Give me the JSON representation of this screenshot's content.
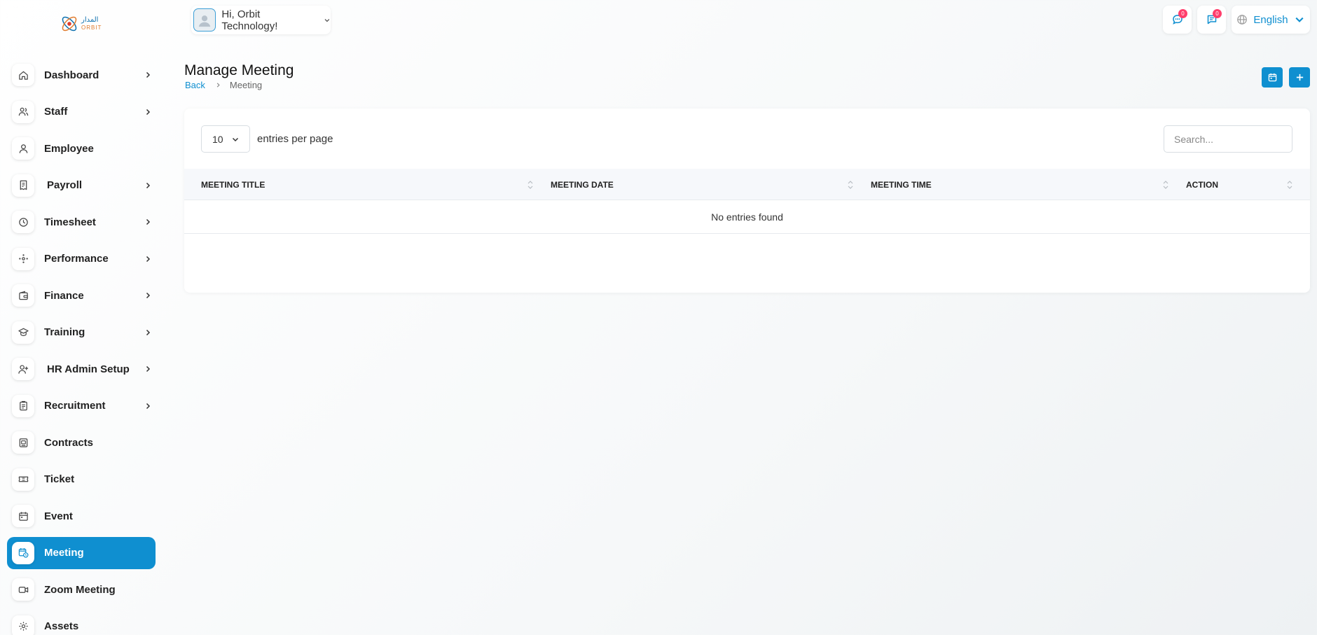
{
  "logo": {
    "arabic": "المدار",
    "latin": "ORBIT"
  },
  "sidebar": {
    "items": [
      {
        "label": "Dashboard",
        "icon": "home-icon",
        "chevron": true
      },
      {
        "label": "Staff",
        "icon": "users-icon",
        "chevron": true
      },
      {
        "label": "Employee",
        "icon": "user-icon",
        "chevron": false
      },
      {
        "label": "Payroll",
        "icon": "receipt-icon",
        "chevron": true
      },
      {
        "label": "Timesheet",
        "icon": "clock-icon",
        "chevron": true
      },
      {
        "label": "Performance",
        "icon": "performance-icon",
        "chevron": true
      },
      {
        "label": "Finance",
        "icon": "wallet-icon",
        "chevron": true
      },
      {
        "label": "Training",
        "icon": "graduation-cap-icon",
        "chevron": true
      },
      {
        "label": "HR Admin Setup",
        "icon": "user-plus-icon",
        "chevron": true
      },
      {
        "label": "Recruitment",
        "icon": "clipboard-icon",
        "chevron": true
      },
      {
        "label": "Contracts",
        "icon": "contract-icon",
        "chevron": false
      },
      {
        "label": "Ticket",
        "icon": "ticket-icon",
        "chevron": false
      },
      {
        "label": "Event",
        "icon": "calendar-icon",
        "chevron": false
      },
      {
        "label": "Meeting",
        "icon": "calendar-clock-icon",
        "chevron": false,
        "active": true
      },
      {
        "label": "Zoom Meeting",
        "icon": "video-icon",
        "chevron": false
      },
      {
        "label": "Assets",
        "icon": "gear-icon",
        "chevron": false
      }
    ]
  },
  "header": {
    "user_greeting": "Hi, Orbit Technology!",
    "messages_count": "0",
    "notifications_count": "0",
    "language": "English"
  },
  "page": {
    "title": "Manage Meeting",
    "breadcrumb_back": "Back",
    "breadcrumb_current": "Meeting"
  },
  "table": {
    "per_page_value": "10",
    "per_page_label": "entries per page",
    "search_placeholder": "Search...",
    "columns": [
      "MEETING TITLE",
      "MEETING DATE",
      "MEETING TIME",
      "ACTION"
    ],
    "empty_text": "No entries found"
  },
  "colors": {
    "accent": "#0f8fd0",
    "badge": "#ff3e6c"
  }
}
